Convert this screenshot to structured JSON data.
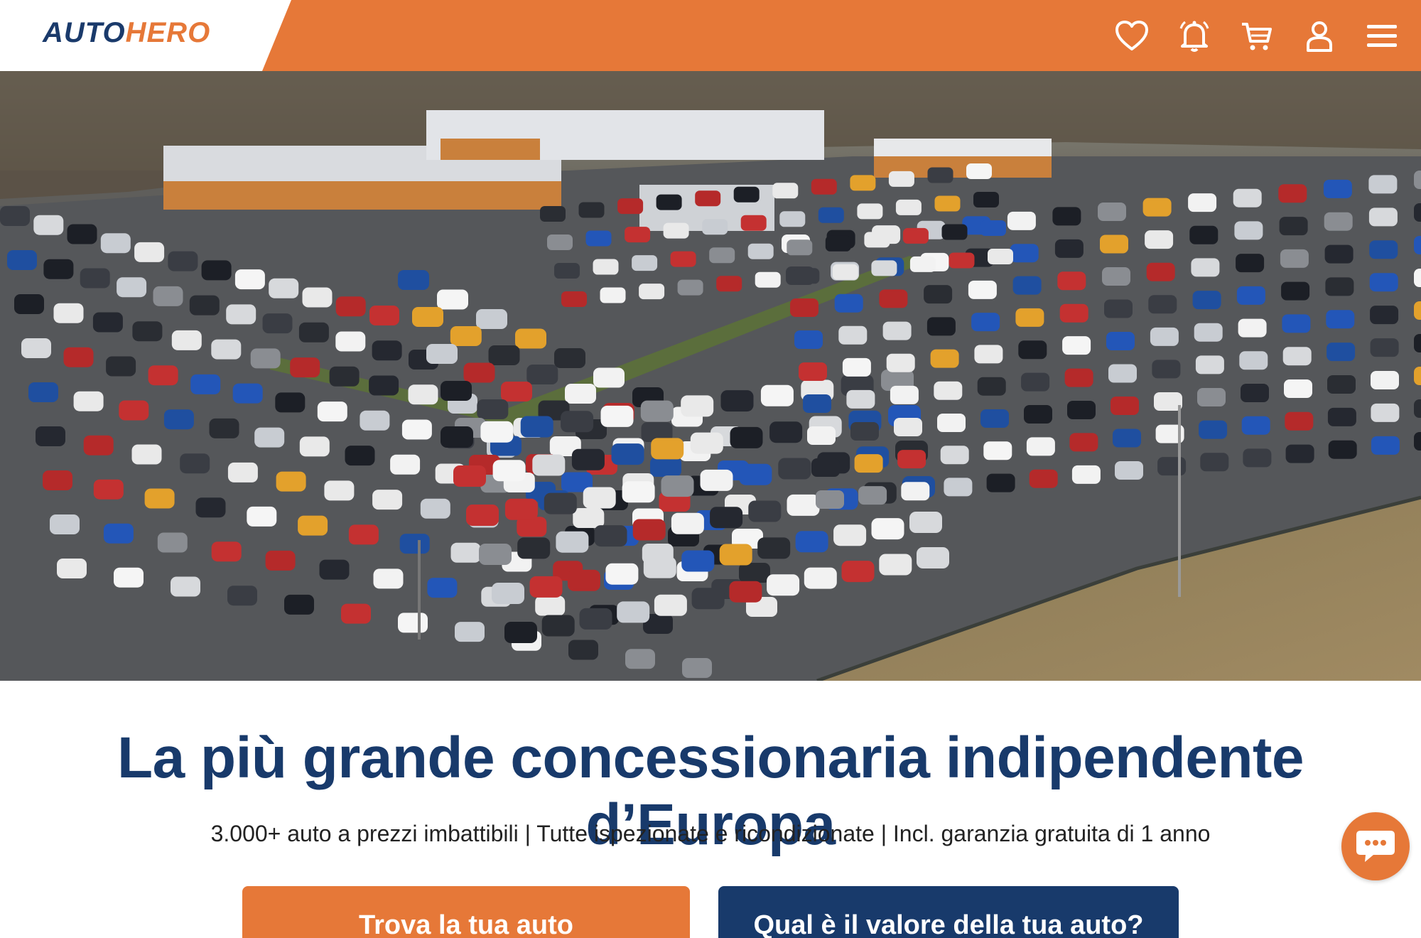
{
  "header": {
    "logo_part1": "AUTO",
    "logo_part2": "HERO",
    "icons": [
      "heart-icon",
      "bell-icon",
      "cart-icon",
      "user-icon",
      "menu-icon"
    ]
  },
  "hero": {
    "headline": "La più grande concessionaria indipendente d’Europa",
    "subline": "3.000+ auto a prezzi imbattibili | Tutte ispezionate e ricondizionate | Incl. garanzia gratuita di 1 anno"
  },
  "buttons": {
    "primary_label": "Trova la tua auto",
    "secondary_label": "Qual è il valore della tua auto?"
  },
  "colors": {
    "brand_orange": "#e67838",
    "brand_navy": "#183a6b"
  },
  "chat": {
    "icon": "chat-bubble-icon"
  }
}
